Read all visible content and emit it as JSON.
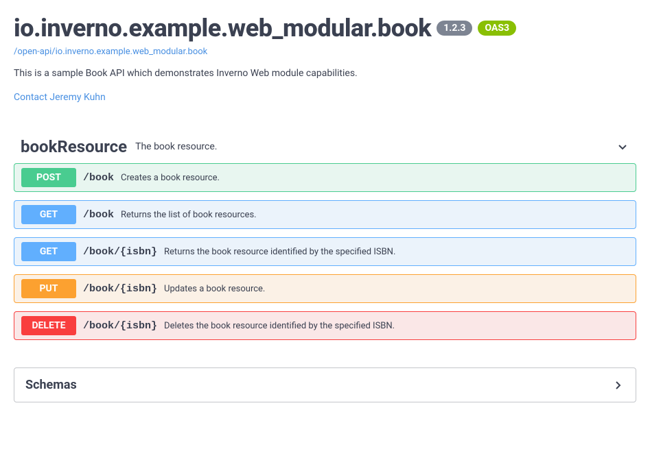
{
  "header": {
    "title": "io.inverno.example.web_modular.book",
    "version": "1.2.3",
    "oas": "OAS3",
    "spec_link": "/open-api/io.inverno.example.web_modular.book",
    "description": "This is a sample Book API which demonstrates Inverno Web module capabilities.",
    "contact": "Contact Jeremy Kuhn"
  },
  "tag": {
    "name": "bookResource",
    "description": "The book resource."
  },
  "operations": [
    {
      "method": "POST",
      "method_class": "post",
      "path": "/book",
      "summary": "Creates a book resource."
    },
    {
      "method": "GET",
      "method_class": "get",
      "path": "/book",
      "summary": "Returns the list of book resources."
    },
    {
      "method": "GET",
      "method_class": "get",
      "path": "/book/{isbn}",
      "summary": "Returns the book resource identified by the specified ISBN."
    },
    {
      "method": "PUT",
      "method_class": "put",
      "path": "/book/{isbn}",
      "summary": "Updates a book resource."
    },
    {
      "method": "DELETE",
      "method_class": "delete",
      "path": "/book/{isbn}",
      "summary": "Deletes the book resource identified by the specified ISBN."
    }
  ],
  "schemas": {
    "title": "Schemas"
  }
}
